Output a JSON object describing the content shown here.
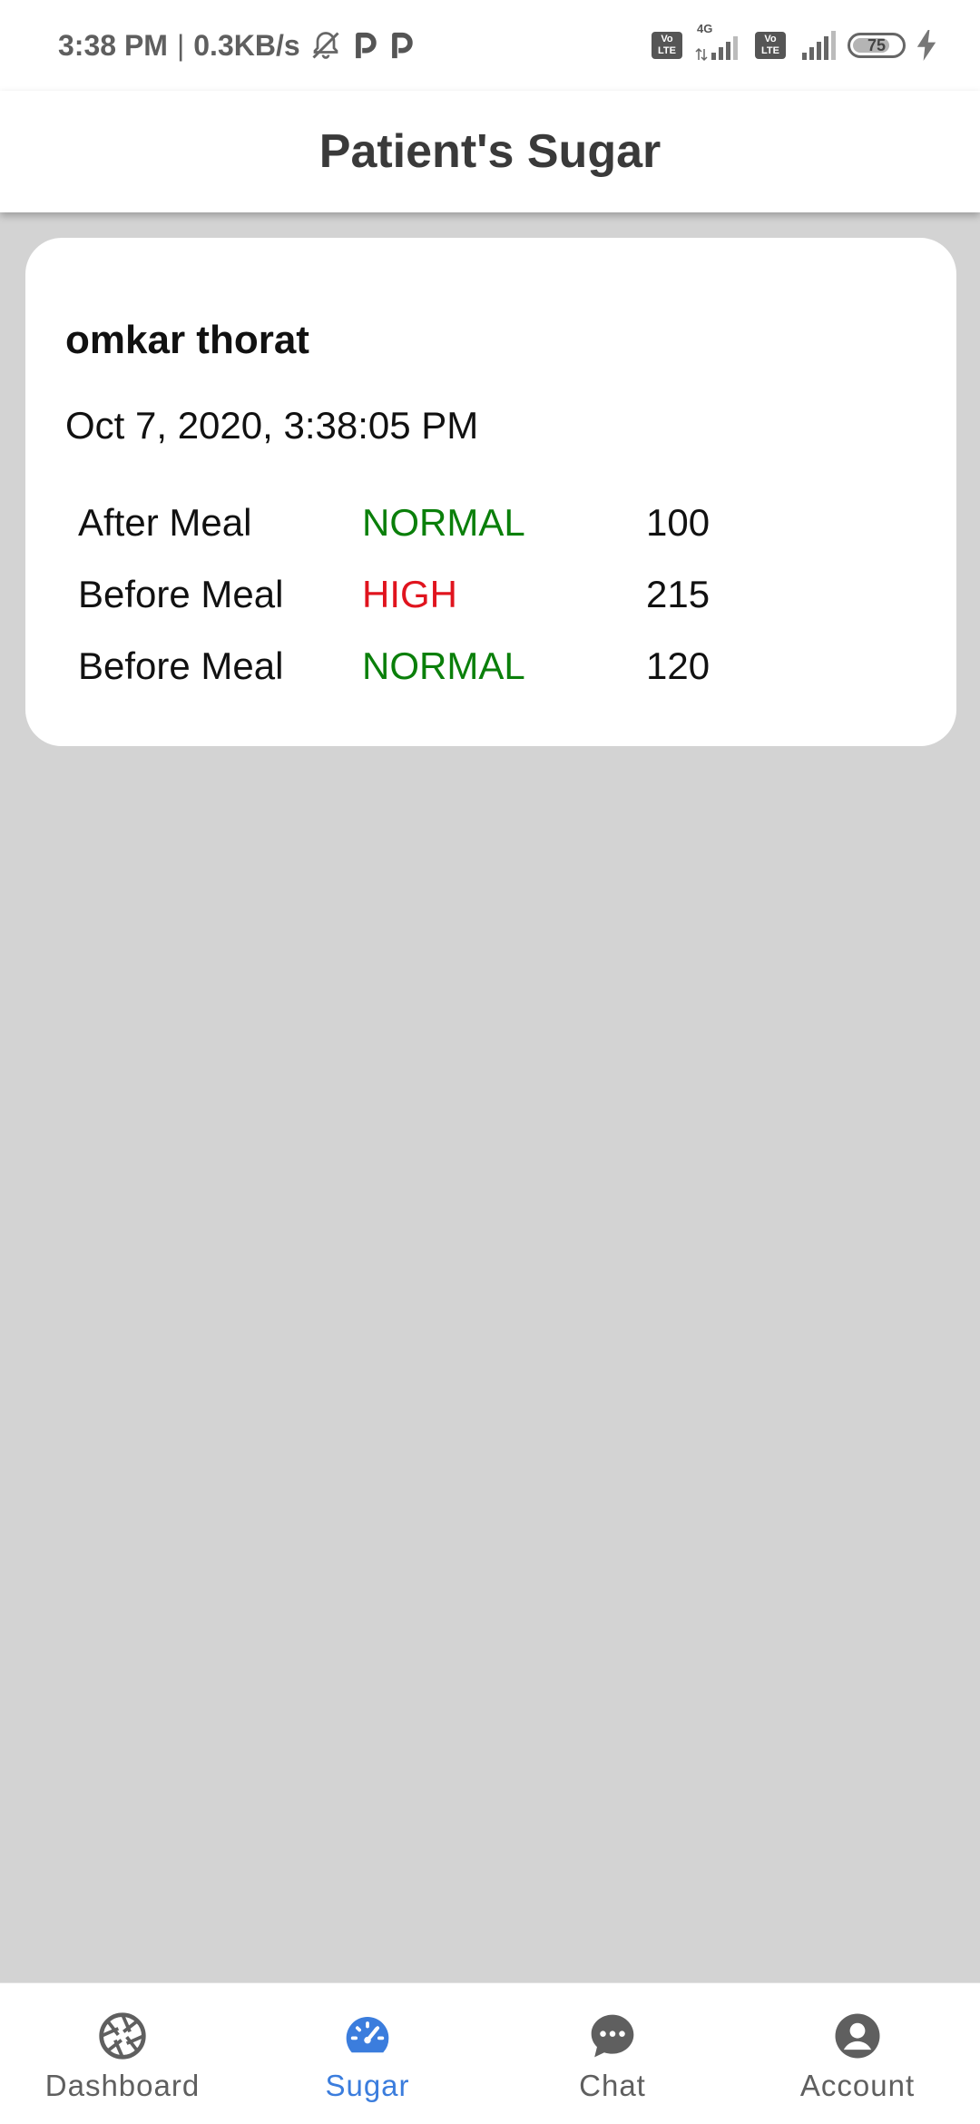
{
  "status_bar": {
    "time": "3:38 PM",
    "separator": "|",
    "network_speed": "0.3KB/s",
    "network_type": "4G",
    "volte_top": "Vo",
    "volte_bottom": "LTE",
    "battery": "75",
    "icons": [
      "mute-icon",
      "paytm-icon",
      "paytm-icon",
      "volte-icon",
      "signal-icon",
      "volte-icon",
      "signal-icon",
      "battery-icon",
      "charging-icon"
    ]
  },
  "app_bar": {
    "title": "Patient's Sugar"
  },
  "record": {
    "patient_name": "omkar thorat",
    "date": "Oct 7, 2020, 3:38:05 PM",
    "readings": [
      {
        "meal": "After Meal",
        "status": "NORMAL",
        "value": "100",
        "status_color": "#0a7f0a"
      },
      {
        "meal": "Before Meal",
        "status": "HIGH",
        "value": "215",
        "status_color": "#e0141e"
      },
      {
        "meal": "Before Meal",
        "status": "NORMAL",
        "value": "120",
        "status_color": "#0a7f0a"
      }
    ]
  },
  "bottom_nav": {
    "active_color": "#3b7ddd",
    "items": [
      {
        "label": "Dashboard",
        "icon": "aperture-icon",
        "active": false
      },
      {
        "label": "Sugar",
        "icon": "speedometer-icon",
        "active": true
      },
      {
        "label": "Chat",
        "icon": "chat-bubble-icon",
        "active": false
      },
      {
        "label": "Account",
        "icon": "account-circle-icon",
        "active": false
      }
    ]
  }
}
